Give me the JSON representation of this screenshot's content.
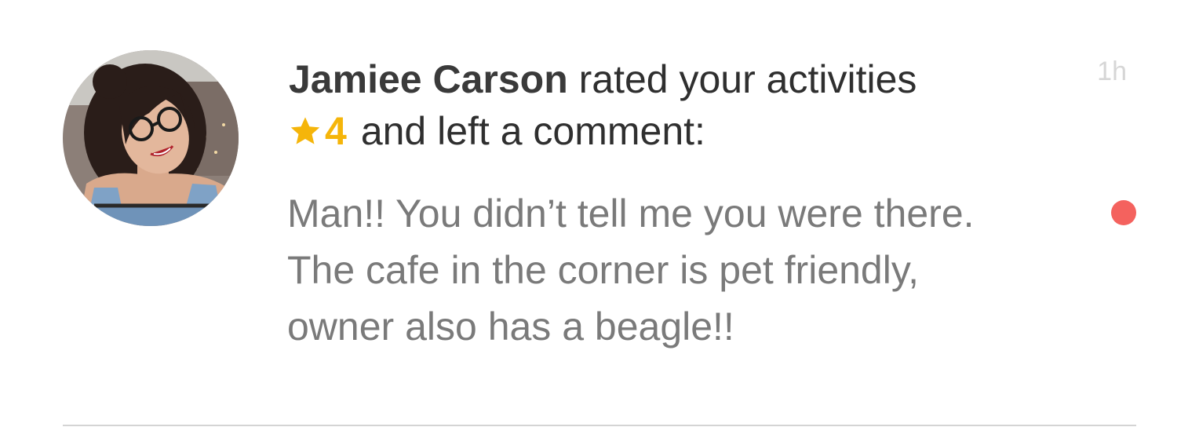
{
  "notification": {
    "user_name": "Jamiee Carson",
    "action_text": " rated your activities",
    "rating_value": "4",
    "after_rating_text": "and left a comment:",
    "time_ago": "1h",
    "comment": "Man!! You didn’t tell me you were there. The cafe in the corner is pet friendly, owner also has a beagle!!",
    "unread": true
  },
  "icons": {
    "rating": "star-icon",
    "avatar": "user-avatar-photo"
  },
  "colors": {
    "star": "#f5b50a",
    "unread_dot": "#f4625e",
    "name_text": "#3a3a3a",
    "body_text": "#7a7a7a",
    "time_text": "#d6d6d6",
    "divider": "#d4d4d4"
  }
}
